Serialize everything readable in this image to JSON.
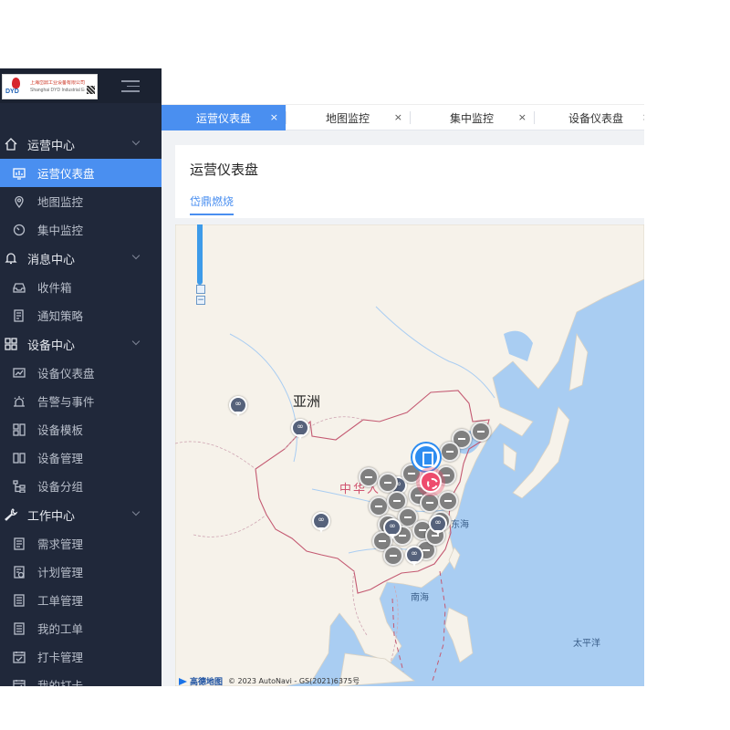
{
  "sidebar": {
    "logo": {
      "mark_text": "DYD",
      "company_cn": "上海岱鼎工业设备有限公司",
      "company_en": "Shanghai DYD Industrial Equipment Co.,Ltd"
    },
    "groups": [
      {
        "label": "运营中心",
        "icon": "home-icon",
        "items": [
          {
            "label": "运营仪表盘",
            "icon": "dashboard-icon",
            "active": true
          },
          {
            "label": "地图监控",
            "icon": "location-icon"
          },
          {
            "label": "集中监控",
            "icon": "gauge-icon"
          }
        ]
      },
      {
        "label": "消息中心",
        "icon": "bell-icon",
        "items": [
          {
            "label": "收件箱",
            "icon": "inbox-icon"
          },
          {
            "label": "通知策略",
            "icon": "policy-icon"
          }
        ]
      },
      {
        "label": "设备中心",
        "icon": "grid-icon",
        "items": [
          {
            "label": "设备仪表盘",
            "icon": "chart-icon"
          },
          {
            "label": "告警与事件",
            "icon": "alarm-icon"
          },
          {
            "label": "设备模板",
            "icon": "template-icon"
          },
          {
            "label": "设备管理",
            "icon": "manage-icon"
          },
          {
            "label": "设备分组",
            "icon": "tree-icon"
          }
        ]
      },
      {
        "label": "工作中心",
        "icon": "wrench-icon",
        "items": [
          {
            "label": "需求管理",
            "icon": "doc-icon"
          },
          {
            "label": "计划管理",
            "icon": "plan-icon"
          },
          {
            "label": "工单管理",
            "icon": "order-icon"
          },
          {
            "label": "我的工单",
            "icon": "list-icon"
          },
          {
            "label": "打卡管理",
            "icon": "calendar-icon"
          },
          {
            "label": "我的打卡",
            "icon": "calendar-icon"
          }
        ]
      }
    ]
  },
  "tabs": [
    {
      "label": "运营仪表盘",
      "active": true
    },
    {
      "label": "地图监控"
    },
    {
      "label": "集中监控"
    },
    {
      "label": "设备仪表盘"
    }
  ],
  "tab_close_glyph": "×",
  "page": {
    "title": "运营仪表盘",
    "subtab": "岱鼎燃烧"
  },
  "map": {
    "labels": {
      "asia": "亚洲",
      "china": "中华人",
      "east_sea": "东海",
      "south_sea": "南海",
      "pacific": "太平洋"
    },
    "attribution_brand": "高德地图",
    "attribution_text": "© 2023 AutoNavi - GS(2021)6375号",
    "zoom_minus": "−",
    "colors": {
      "land": "#f6f2ea",
      "water": "#a9cdf2",
      "border": "#c45a72",
      "accent": "#4a8ff0"
    }
  }
}
